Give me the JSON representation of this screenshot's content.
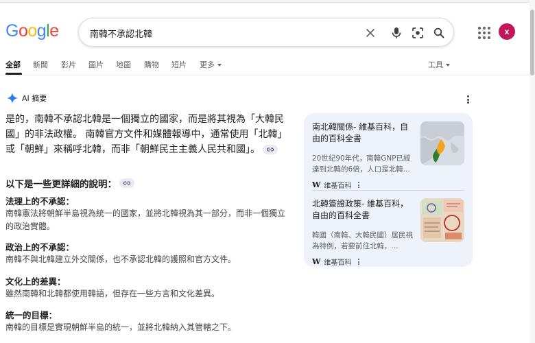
{
  "colors": {
    "accent": "#1a73e8",
    "avatar": "#c2185b",
    "sidecard_bg": "#eef2fb",
    "logo_blue": "#4285f4",
    "logo_red": "#ea4335",
    "logo_yellow": "#fbbc05",
    "logo_green": "#34a853"
  },
  "header": {
    "logo_letters": [
      "G",
      "o",
      "o",
      "g",
      "l",
      "e"
    ],
    "search_value": "南韓不承認北韓",
    "avatar_letter": "x",
    "icons": [
      "clear-icon",
      "mic-icon",
      "lens-icon",
      "search-icon",
      "apps-icon"
    ]
  },
  "tabs": {
    "items": [
      "全部",
      "新聞",
      "影片",
      "圖片",
      "地圖",
      "購物",
      "短片",
      "更多"
    ],
    "tools": "工具"
  },
  "ai": {
    "title": "AI 摘要",
    "summary": "是的，南韓不承認北韓是一個獨立的國家，而是將其視為「大韓民國」的非法政權。 南韓官方文件和媒體報導中，通常使用「北韓」或「朝鮮」來稱呼北韓，而非「朝鮮民主主義人民共和國」。",
    "subheading": "以下是一些更詳細的說明：",
    "sections": [
      {
        "title": "法理上的不承認：",
        "text": "南韓憲法將朝鮮半島視為統一的國家，並將北韓視為其一部分，而非一個獨立的政治實體。"
      },
      {
        "title": "政治上的不承認：",
        "text": "南韓不與北韓建立外交關係，也不承認北韓的護照和官方文件。"
      },
      {
        "title": "文化上的差異：",
        "text": "雖然南韓和北韓都使用韓語，但存在一些方言和文化差異。"
      },
      {
        "title": "統一的目標：",
        "text": "南韓的目標是實現朝鮮半島的統一，並將北韓納入其管轄之下。"
      }
    ]
  },
  "cards": [
    {
      "title": "南北韓關係- 維基百科，自由的百科全書",
      "snippet": "20世紀90年代，南韓GNP已經達到北韓的6倍，人口是北韓...",
      "source": "维基百科",
      "thumb_icon": "map-thumbnail-icon"
    },
    {
      "title": "北韓簽證政策- 維基百科，自由的百科全書",
      "snippet": "韓國（南韓、大韓民國）居民視為特例，若要前往北韓，...",
      "source": "维基百科",
      "thumb_icon": "visa-stamp-thumbnail-icon"
    }
  ]
}
